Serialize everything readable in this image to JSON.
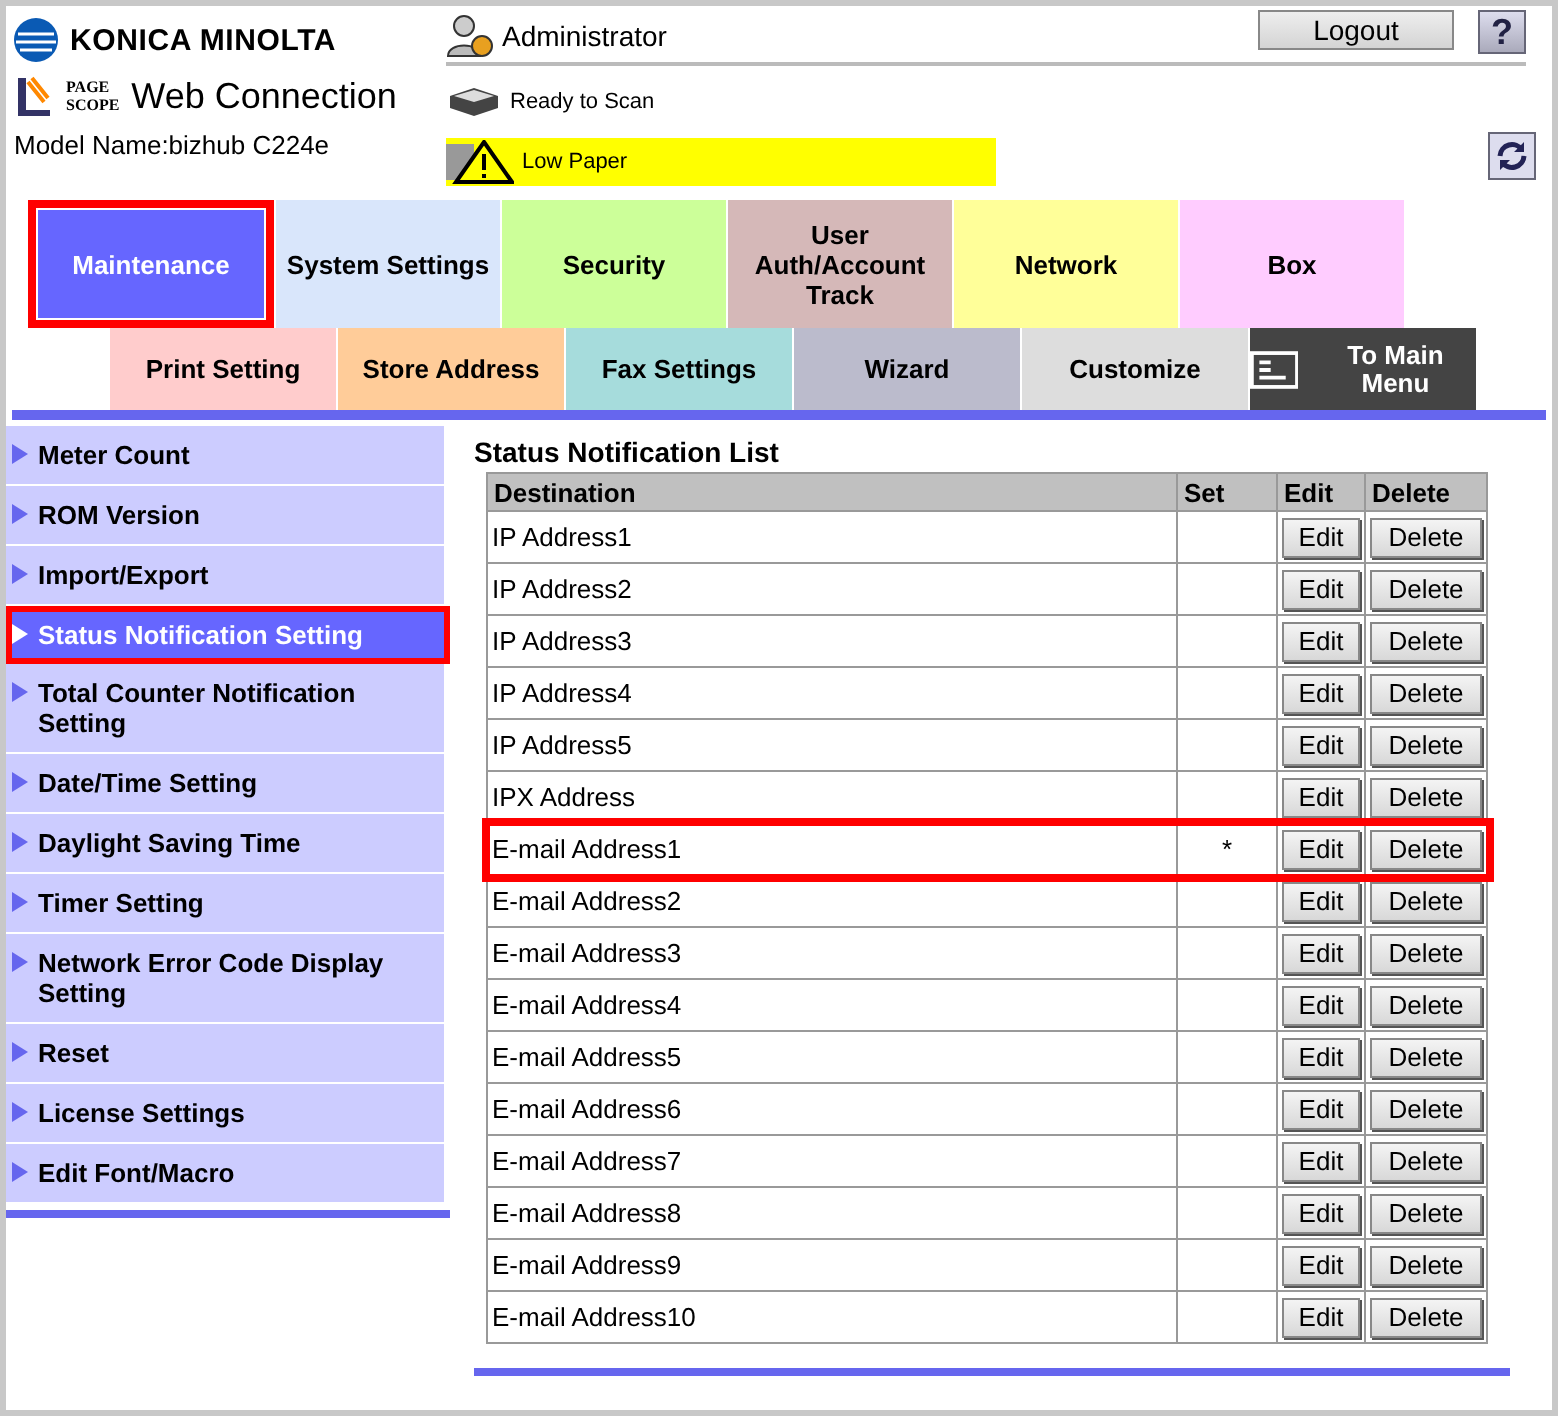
{
  "header": {
    "brand": "KONICA MINOLTA",
    "product_mark_top": "PAGE",
    "product_mark_bottom": "SCOPE",
    "product": "Web Connection",
    "model": "Model Name:bizhub C224e",
    "user": "Administrator",
    "logout": "Logout",
    "help": "?",
    "statuses": [
      {
        "kind": "ready",
        "text": "Ready to Scan"
      },
      {
        "kind": "warning",
        "text": "Low Paper"
      }
    ]
  },
  "main_tabs": [
    {
      "label": "Maintenance",
      "color": "#6666ff",
      "selected": true,
      "highlighted": true
    },
    {
      "label": "System Settings",
      "color": "#d9e6fb",
      "selected": false,
      "highlighted": false
    },
    {
      "label": "Security",
      "color": "#ccff99",
      "selected": false,
      "highlighted": false
    },
    {
      "label": "User Auth/Account Track",
      "color": "#d5b8b8",
      "selected": false,
      "highlighted": false
    },
    {
      "label": "Network",
      "color": "#ffff99",
      "selected": false,
      "highlighted": false
    },
    {
      "label": "Box",
      "color": "#ffccff",
      "selected": false,
      "highlighted": false
    }
  ],
  "sub_tabs": [
    {
      "label": "Print Setting",
      "color": "#ffcccc",
      "kind": "tab"
    },
    {
      "label": "Store Address",
      "color": "#ffcc99",
      "kind": "tab"
    },
    {
      "label": "Fax Settings",
      "color": "#a6dcdc",
      "kind": "tab"
    },
    {
      "label": "Wizard",
      "color": "#bbbbcc",
      "kind": "tab"
    },
    {
      "label": "Customize",
      "color": "#dddddd",
      "kind": "tab"
    },
    {
      "label": "To Main Menu",
      "color": "#444444",
      "kind": "home"
    }
  ],
  "sidebar": {
    "items": [
      {
        "label": "Meter Count",
        "selected": false,
        "highlighted": false
      },
      {
        "label": "ROM Version",
        "selected": false,
        "highlighted": false
      },
      {
        "label": "Import/Export",
        "selected": false,
        "highlighted": false
      },
      {
        "label": "Status Notification Setting",
        "selected": true,
        "highlighted": true
      },
      {
        "label": "Total Counter Notification Setting",
        "selected": false,
        "highlighted": false
      },
      {
        "label": "Date/Time Setting",
        "selected": false,
        "highlighted": false
      },
      {
        "label": "Daylight Saving Time",
        "selected": false,
        "highlighted": false
      },
      {
        "label": "Timer Setting",
        "selected": false,
        "highlighted": false
      },
      {
        "label": "Network Error Code Display Setting",
        "selected": false,
        "highlighted": false
      },
      {
        "label": "Reset",
        "selected": false,
        "highlighted": false
      },
      {
        "label": "License Settings",
        "selected": false,
        "highlighted": false
      },
      {
        "label": "Edit Font/Macro",
        "selected": false,
        "highlighted": false
      }
    ]
  },
  "table": {
    "title": "Status Notification List",
    "columns": [
      "Destination",
      "Set",
      "Edit",
      "Delete"
    ],
    "rows": [
      {
        "destination": "IP Address1",
        "set": "",
        "edit": "Edit",
        "delete": "Delete",
        "highlighted": false
      },
      {
        "destination": "IP Address2",
        "set": "",
        "edit": "Edit",
        "delete": "Delete",
        "highlighted": false
      },
      {
        "destination": "IP Address3",
        "set": "",
        "edit": "Edit",
        "delete": "Delete",
        "highlighted": false
      },
      {
        "destination": "IP Address4",
        "set": "",
        "edit": "Edit",
        "delete": "Delete",
        "highlighted": false
      },
      {
        "destination": "IP Address5",
        "set": "",
        "edit": "Edit",
        "delete": "Delete",
        "highlighted": false
      },
      {
        "destination": "IPX Address",
        "set": "",
        "edit": "Edit",
        "delete": "Delete",
        "highlighted": false
      },
      {
        "destination": "E-mail Address1",
        "set": "*",
        "edit": "Edit",
        "delete": "Delete",
        "highlighted": true
      },
      {
        "destination": "E-mail Address2",
        "set": "",
        "edit": "Edit",
        "delete": "Delete",
        "highlighted": false
      },
      {
        "destination": "E-mail Address3",
        "set": "",
        "edit": "Edit",
        "delete": "Delete",
        "highlighted": false
      },
      {
        "destination": "E-mail Address4",
        "set": "",
        "edit": "Edit",
        "delete": "Delete",
        "highlighted": false
      },
      {
        "destination": "E-mail Address5",
        "set": "",
        "edit": "Edit",
        "delete": "Delete",
        "highlighted": false
      },
      {
        "destination": "E-mail Address6",
        "set": "",
        "edit": "Edit",
        "delete": "Delete",
        "highlighted": false
      },
      {
        "destination": "E-mail Address7",
        "set": "",
        "edit": "Edit",
        "delete": "Delete",
        "highlighted": false
      },
      {
        "destination": "E-mail Address8",
        "set": "",
        "edit": "Edit",
        "delete": "Delete",
        "highlighted": false
      },
      {
        "destination": "E-mail Address9",
        "set": "",
        "edit": "Edit",
        "delete": "Delete",
        "highlighted": false
      },
      {
        "destination": "E-mail Address10",
        "set": "",
        "edit": "Edit",
        "delete": "Delete",
        "highlighted": false
      }
    ]
  }
}
